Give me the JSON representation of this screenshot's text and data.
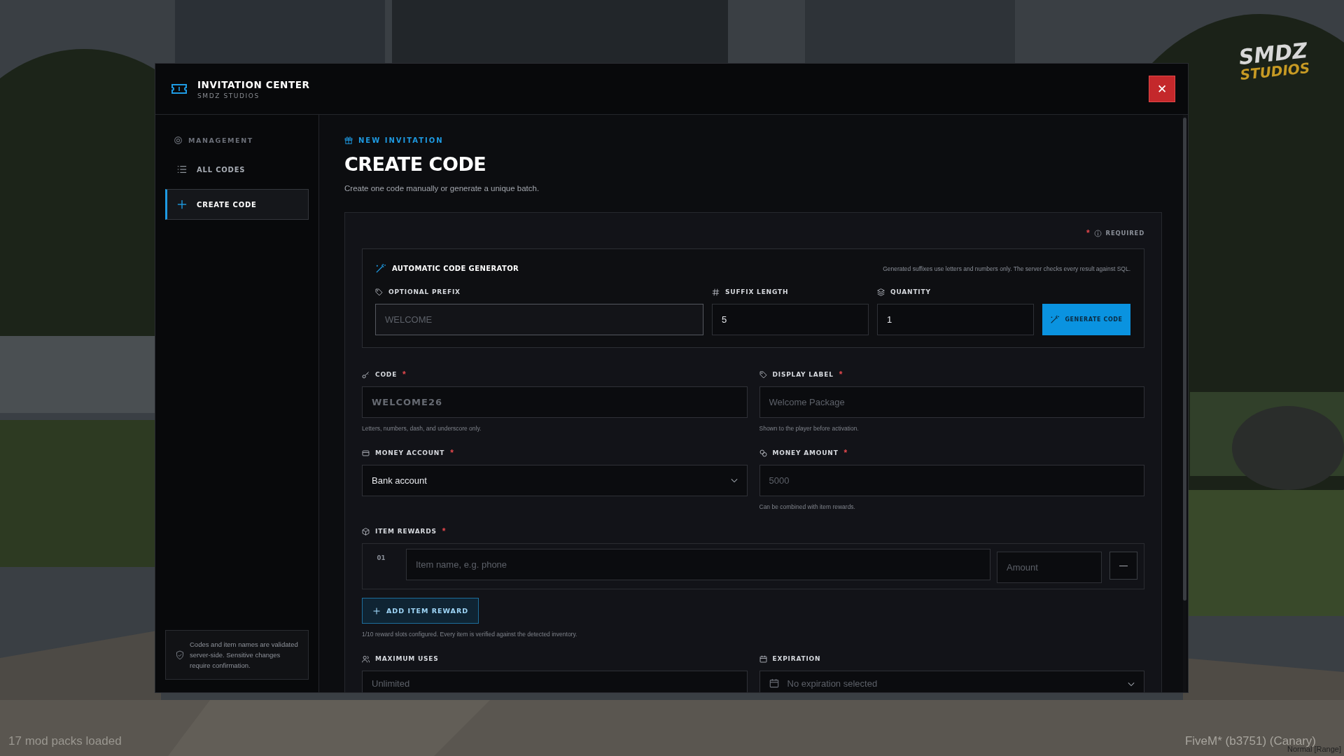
{
  "window": {
    "title": "INVITATION CENTER",
    "subtitle": "SMDZ STUDIOS",
    "close": "✕"
  },
  "sidebar": {
    "section": "MANAGEMENT",
    "items": [
      {
        "label": "ALL CODES",
        "selected": false
      },
      {
        "label": "CREATE CODE",
        "selected": true
      }
    ],
    "note": "Codes and item names are validated server-side. Sensitive changes require confirmation."
  },
  "page": {
    "eyebrow": "NEW INVITATION",
    "title": "CREATE CODE",
    "subtitle": "Create one code manually or generate a unique batch."
  },
  "required_legend": {
    "mark": "*",
    "label": "REQUIRED"
  },
  "generator": {
    "title": "AUTOMATIC CODE GENERATOR",
    "note": "Generated suffixes use letters and numbers only. The server checks every result against SQL.",
    "fields": [
      {
        "label": "OPTIONAL PREFIX",
        "placeholder": "WELCOME",
        "focused": true
      },
      {
        "label": "SUFFIX LENGTH",
        "value": "5",
        "focused": false
      },
      {
        "label": "QUANTITY",
        "value": "1",
        "focused": false
      }
    ],
    "button": "GENERATE CODE"
  },
  "fields": [
    {
      "kind": "code",
      "label": "CODE",
      "required_mark": "*",
      "placeholder": "WELCOME26",
      "hint": "Letters, numbers, dash, and underscore only."
    },
    {
      "kind": "text",
      "label": "DISPLAY LABEL",
      "required_mark": "*",
      "placeholder": "Welcome Package",
      "hint": "Shown to the player before activation."
    },
    {
      "kind": "select",
      "label": "MONEY ACCOUNT",
      "required_mark": "*",
      "value": "Bank account"
    },
    {
      "kind": "text",
      "label": "MONEY AMOUNT",
      "required_mark": "*",
      "placeholder": "5000",
      "hint": "Can be combined with item rewards."
    }
  ],
  "item_rewards": {
    "label": "ITEM REWARDS",
    "required_mark": "*",
    "rows": [
      {
        "index": "01",
        "name_placeholder": "Item name, e.g. phone",
        "amount_placeholder": "Amount",
        "remove": "—"
      }
    ],
    "add_button": "ADD ITEM REWARD",
    "note": "1/10 reward slots configured. Every item is verified against the detected inventory."
  },
  "bottom_fields": [
    {
      "kind": "text",
      "label": "MAXIMUM USES",
      "placeholder": "Unlimited"
    },
    {
      "kind": "date",
      "label": "EXPIRATION",
      "placeholder": "No expiration selected"
    }
  ],
  "logo": {
    "top": "SMDZ",
    "bottom": "STUDIOS"
  },
  "status_left": "17 mod packs loaded",
  "status_right": "FiveM* (b3751) (Canary)",
  "status_overlay": "Normal [Range]"
}
